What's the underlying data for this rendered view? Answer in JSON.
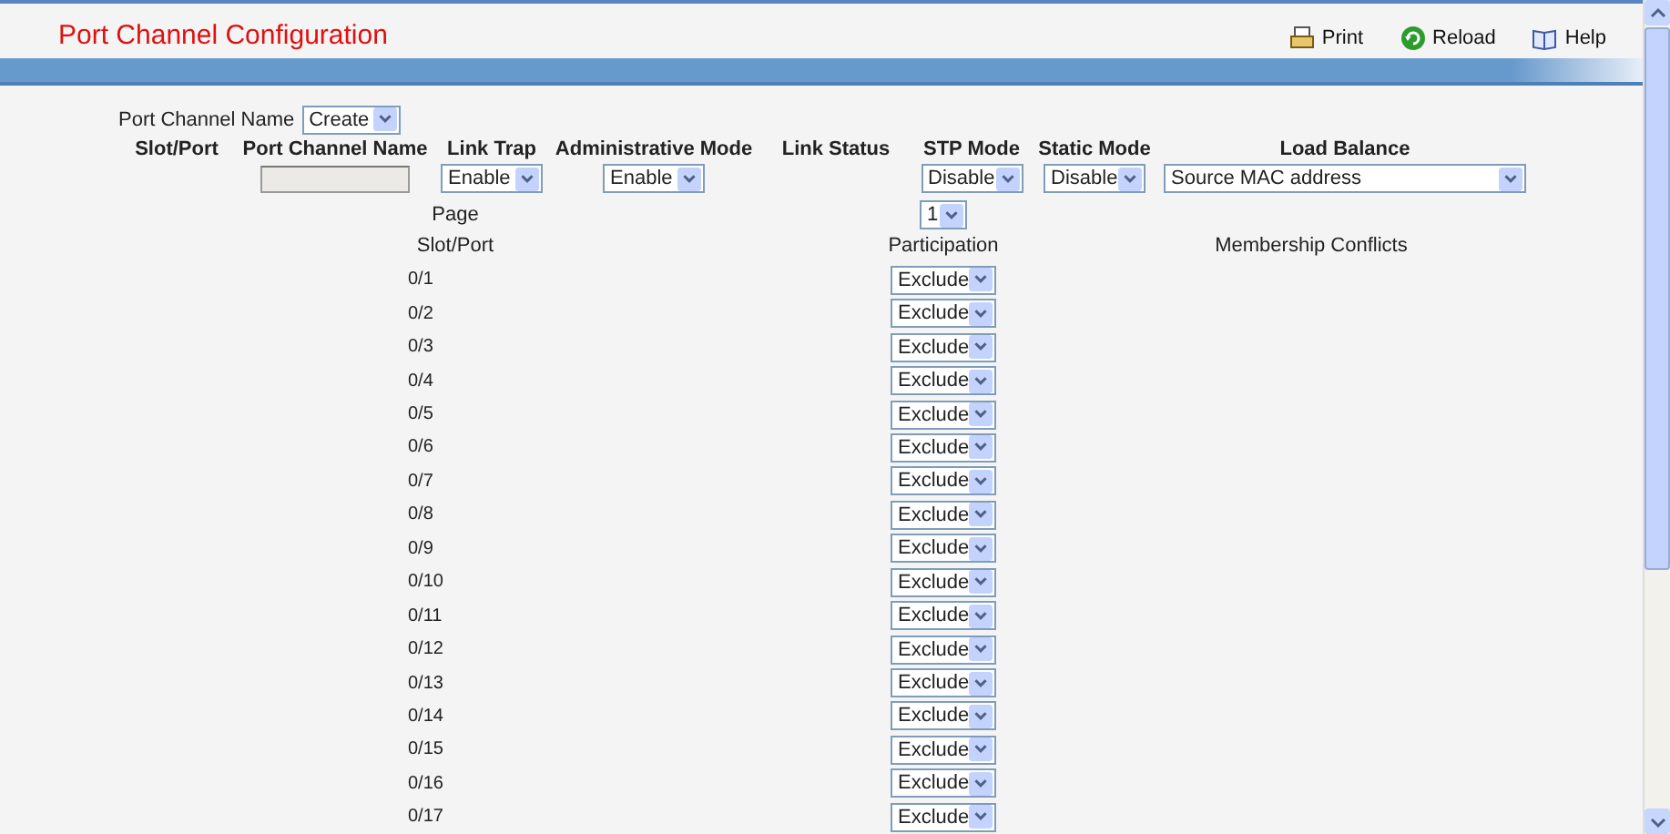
{
  "header": {
    "title": "Port Channel Configuration",
    "actions": [
      {
        "label": "Print",
        "kind": "print"
      },
      {
        "label": "Reload",
        "kind": "reload"
      },
      {
        "label": "Help",
        "kind": "help"
      }
    ]
  },
  "port_channel_name": {
    "label": "Port Channel Name",
    "value": "Create"
  },
  "config_table": {
    "columns": [
      "Slot/Port",
      "Port Channel Name",
      "Link Trap",
      "Administrative Mode",
      "Link Status",
      "STP Mode",
      "Static Mode",
      "Load Balance"
    ],
    "name_field": {
      "disabled": true
    },
    "link_trap": "Enable",
    "administrative_mode": "Enable",
    "stp_mode": "Disable",
    "static_mode": "Disable",
    "load_balance": "Source MAC address"
  },
  "page": {
    "label": "Page",
    "value": "1"
  },
  "ports_table": {
    "columns": [
      "Slot/Port",
      "Participation",
      "Membership Conflicts"
    ],
    "rows": [
      {
        "slot_port": "0/1",
        "participation": "Exclude"
      },
      {
        "slot_port": "0/2",
        "participation": "Exclude"
      },
      {
        "slot_port": "0/3",
        "participation": "Exclude"
      },
      {
        "slot_port": "0/4",
        "participation": "Exclude"
      },
      {
        "slot_port": "0/5",
        "participation": "Exclude"
      },
      {
        "slot_port": "0/6",
        "participation": "Exclude"
      },
      {
        "slot_port": "0/7",
        "participation": "Exclude"
      },
      {
        "slot_port": "0/8",
        "participation": "Exclude"
      },
      {
        "slot_port": "0/9",
        "participation": "Exclude"
      },
      {
        "slot_port": "0/10",
        "participation": "Exclude"
      },
      {
        "slot_port": "0/11",
        "participation": "Exclude"
      },
      {
        "slot_port": "0/12",
        "participation": "Exclude"
      },
      {
        "slot_port": "0/13",
        "participation": "Exclude"
      },
      {
        "slot_port": "0/14",
        "participation": "Exclude"
      },
      {
        "slot_port": "0/15",
        "participation": "Exclude"
      },
      {
        "slot_port": "0/16",
        "participation": "Exclude"
      },
      {
        "slot_port": "0/17",
        "participation": "Exclude"
      }
    ]
  }
}
